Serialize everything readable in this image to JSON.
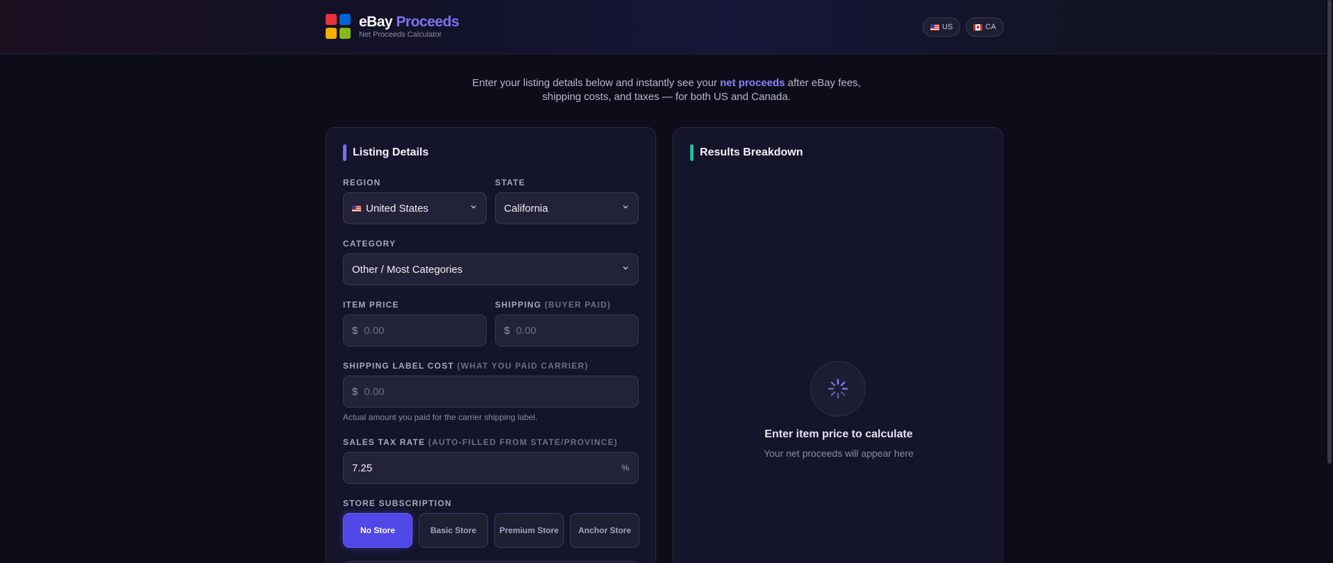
{
  "header": {
    "brand_primary": "eBay",
    "brand_accent": "Proceeds",
    "subtitle": "Net Proceeds Calculator",
    "regions": [
      {
        "label": "US",
        "icon": "us-flag-icon"
      },
      {
        "label": "CA",
        "icon": "ca-flag-icon"
      }
    ]
  },
  "intro": {
    "before": "Enter your listing details below and instantly see your ",
    "highlight": "net proceeds",
    "after": " after eBay fees,",
    "line2": "shipping costs, and taxes — for both US and Canada."
  },
  "listing": {
    "title": "Listing Details",
    "region_label": "Region",
    "region_value": "United States",
    "state_label": "State",
    "state_value": "California",
    "category_label": "Category",
    "category_value": "Other / Most Categories",
    "item_price_label": "Item Price",
    "item_price_prefix": "$",
    "item_price_placeholder": "0.00",
    "shipping_label": "Shipping",
    "shipping_label_note": "(Buyer Paid)",
    "shipping_prefix": "$",
    "shipping_placeholder": "0.00",
    "label_cost_label": "Shipping Label Cost",
    "label_cost_note": "(What you paid carrier)",
    "label_cost_prefix": "$",
    "label_cost_placeholder": "0.00",
    "label_cost_help": "Actual amount you paid for the carrier shipping label.",
    "tax_label": "Sales Tax Rate",
    "tax_note": "(Auto-filled from state/province)",
    "tax_value": "7.25",
    "tax_suffix": "%",
    "store_label": "Store Subscription",
    "store_options": [
      "No Store",
      "Basic Store",
      "Premium Store",
      "Anchor Store"
    ],
    "store_selected": "No Store"
  },
  "results": {
    "title": "Results Breakdown",
    "empty_title": "Enter item price to calculate",
    "empty_subtitle": "Your net proceeds will appear here",
    "icon": "loading-spinner-icon"
  },
  "colors": {
    "accent": "#7c74f0",
    "active_button": "#5146e6",
    "teal_bar": "#1fbfa3",
    "background": "#0d0d1a"
  }
}
